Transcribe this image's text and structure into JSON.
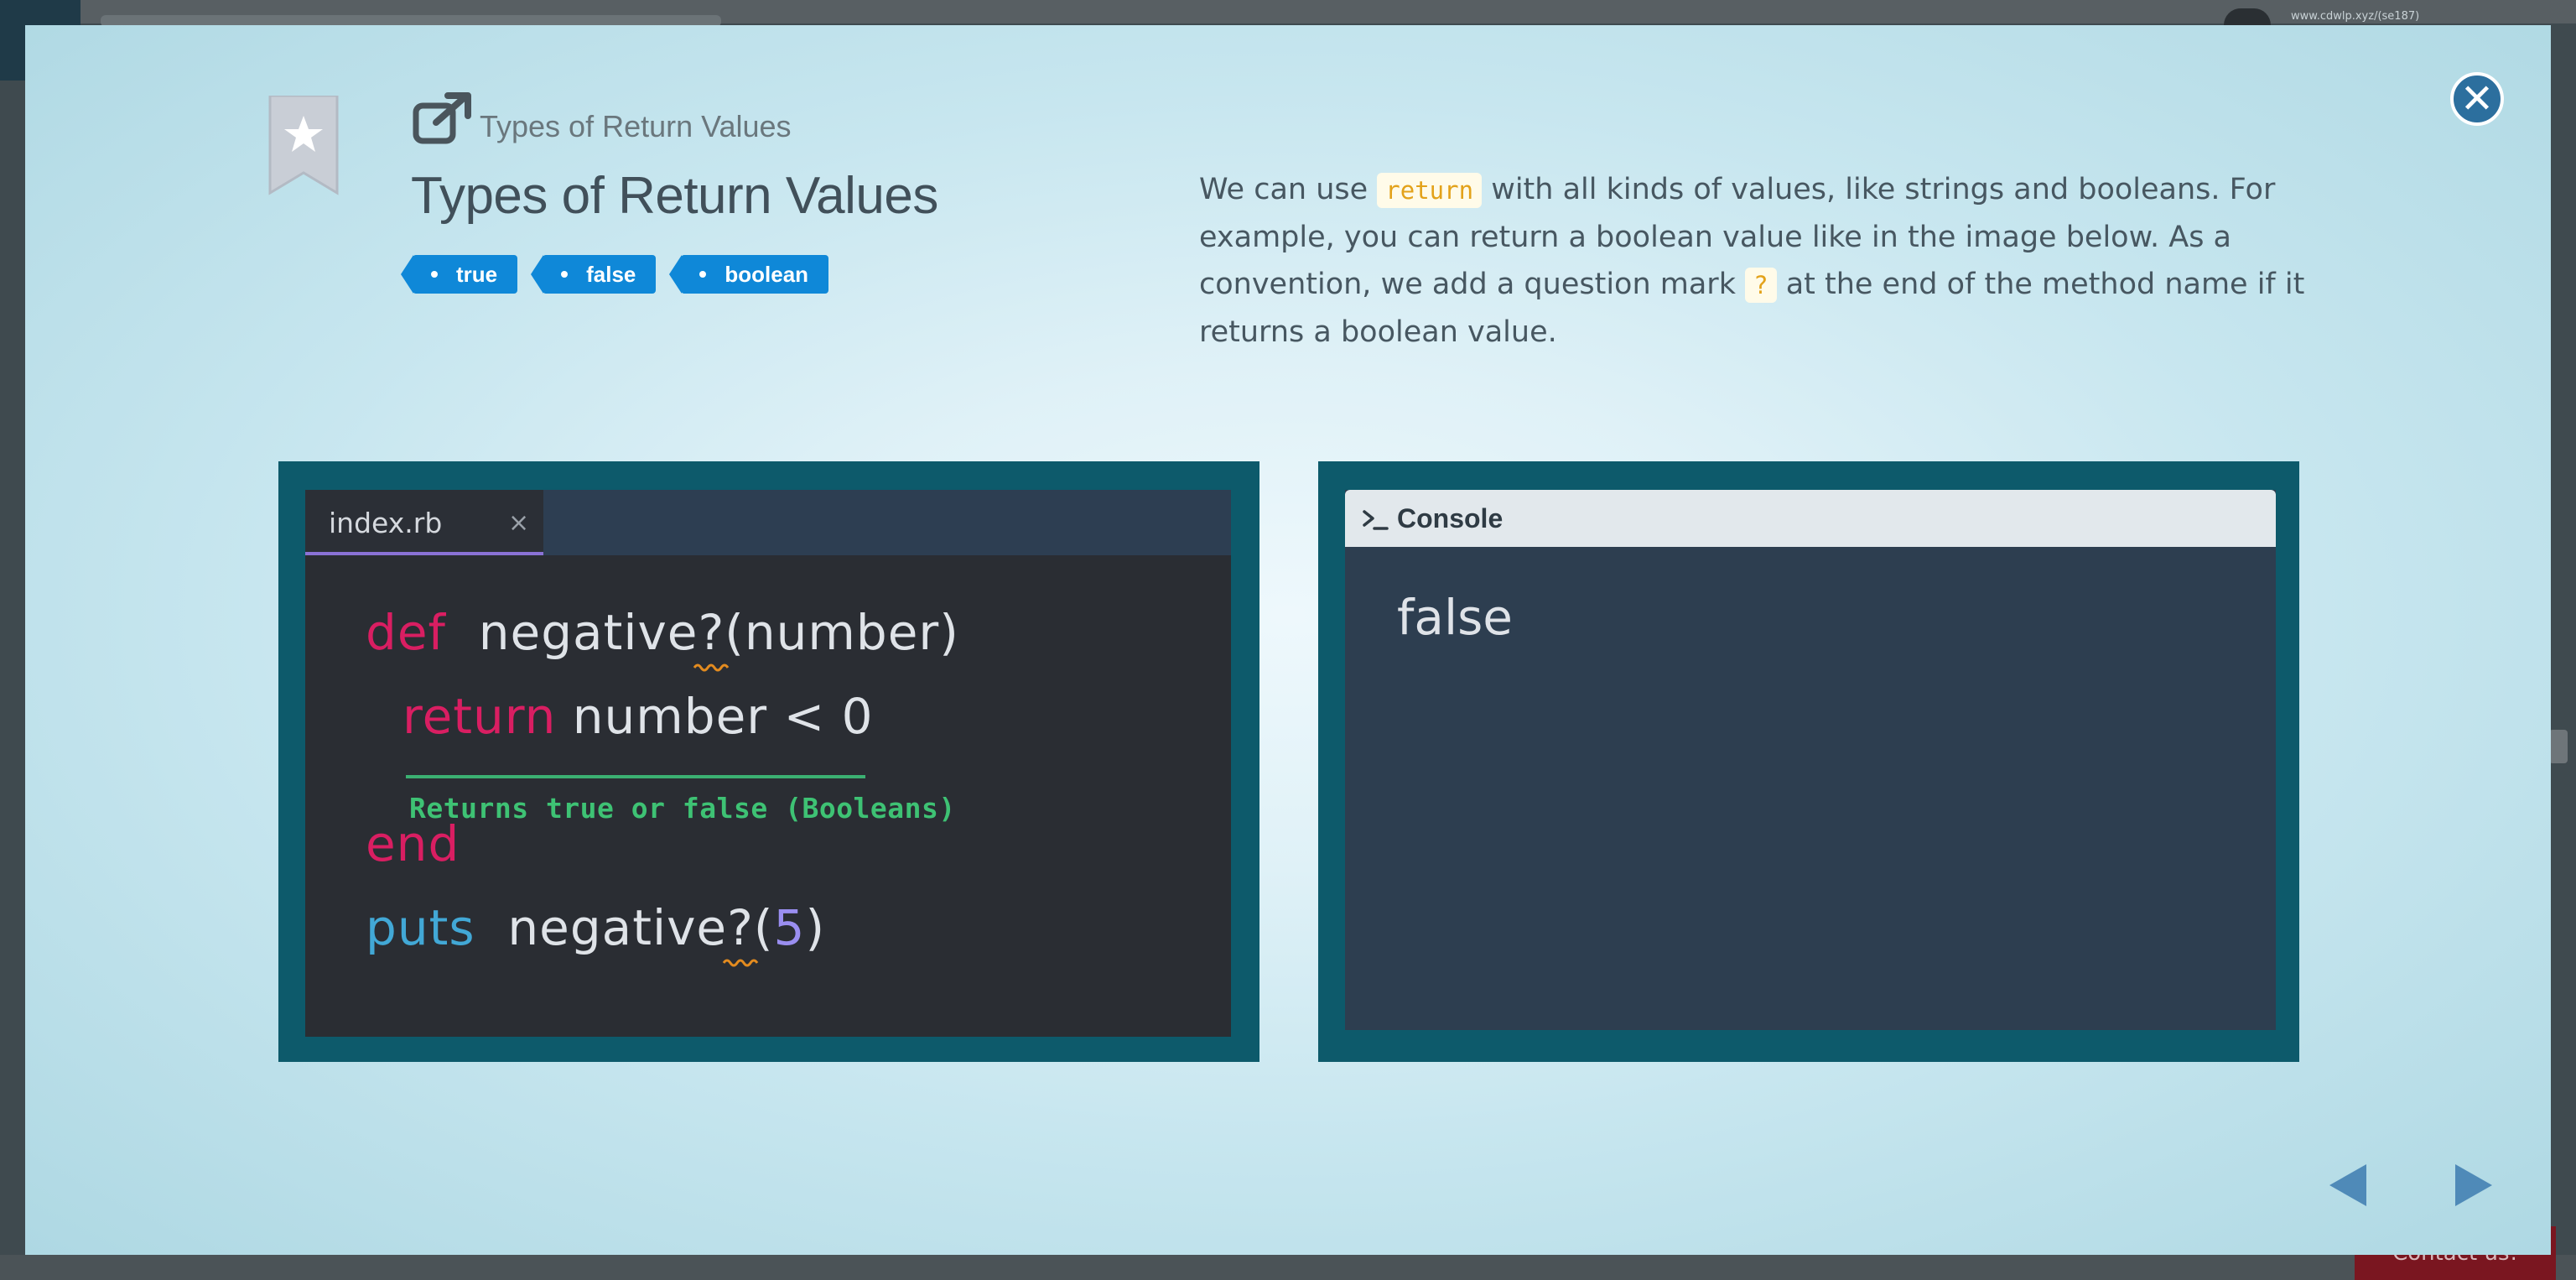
{
  "background": {
    "url_fragment": "www.cdwlp.xyz/(se187)",
    "contact_label": "Contact us!"
  },
  "modal": {
    "breadcrumb": "Types of Return Values",
    "title": "Types of Return Values",
    "tags": [
      "true",
      "false",
      "boolean"
    ],
    "description": {
      "part1": "We can use ",
      "code1": "return",
      "part2": " with all kinds of values, like strings and booleans. For example, you can return a boolean value like in the image below. As a convention, we add a question mark ",
      "code2": "?",
      "part3": " at the end of the method name if it returns a boolean value."
    },
    "editor": {
      "tab_label": "index.rb",
      "tab_close": "×",
      "lines": {
        "l1_kw": "def",
        "l1_name": " negative",
        "l1_q": "?",
        "l1_rest": "(number)",
        "l2_kw": "return",
        "l2_rest": " number < 0",
        "note": "Returns true or false (Booleans)",
        "l3_kw": "end",
        "l4_kw": "puts",
        "l4_name": "  negative",
        "l4_q": "?",
        "l4_open": "(",
        "l4_num": "5",
        "l4_close": ")"
      }
    },
    "console": {
      "title": "Console",
      "output": "false"
    },
    "colors": {
      "accent": "#0f88d8",
      "panel": "#0d5a6b",
      "keyword": "#d91e62",
      "builtin": "#42a8d6",
      "comment": "#3ec274"
    },
    "icons": [
      "bookmark-star-icon",
      "external-link-icon",
      "close-icon",
      "console-prompt-icon",
      "prev-arrow-icon",
      "next-arrow-icon"
    ]
  }
}
